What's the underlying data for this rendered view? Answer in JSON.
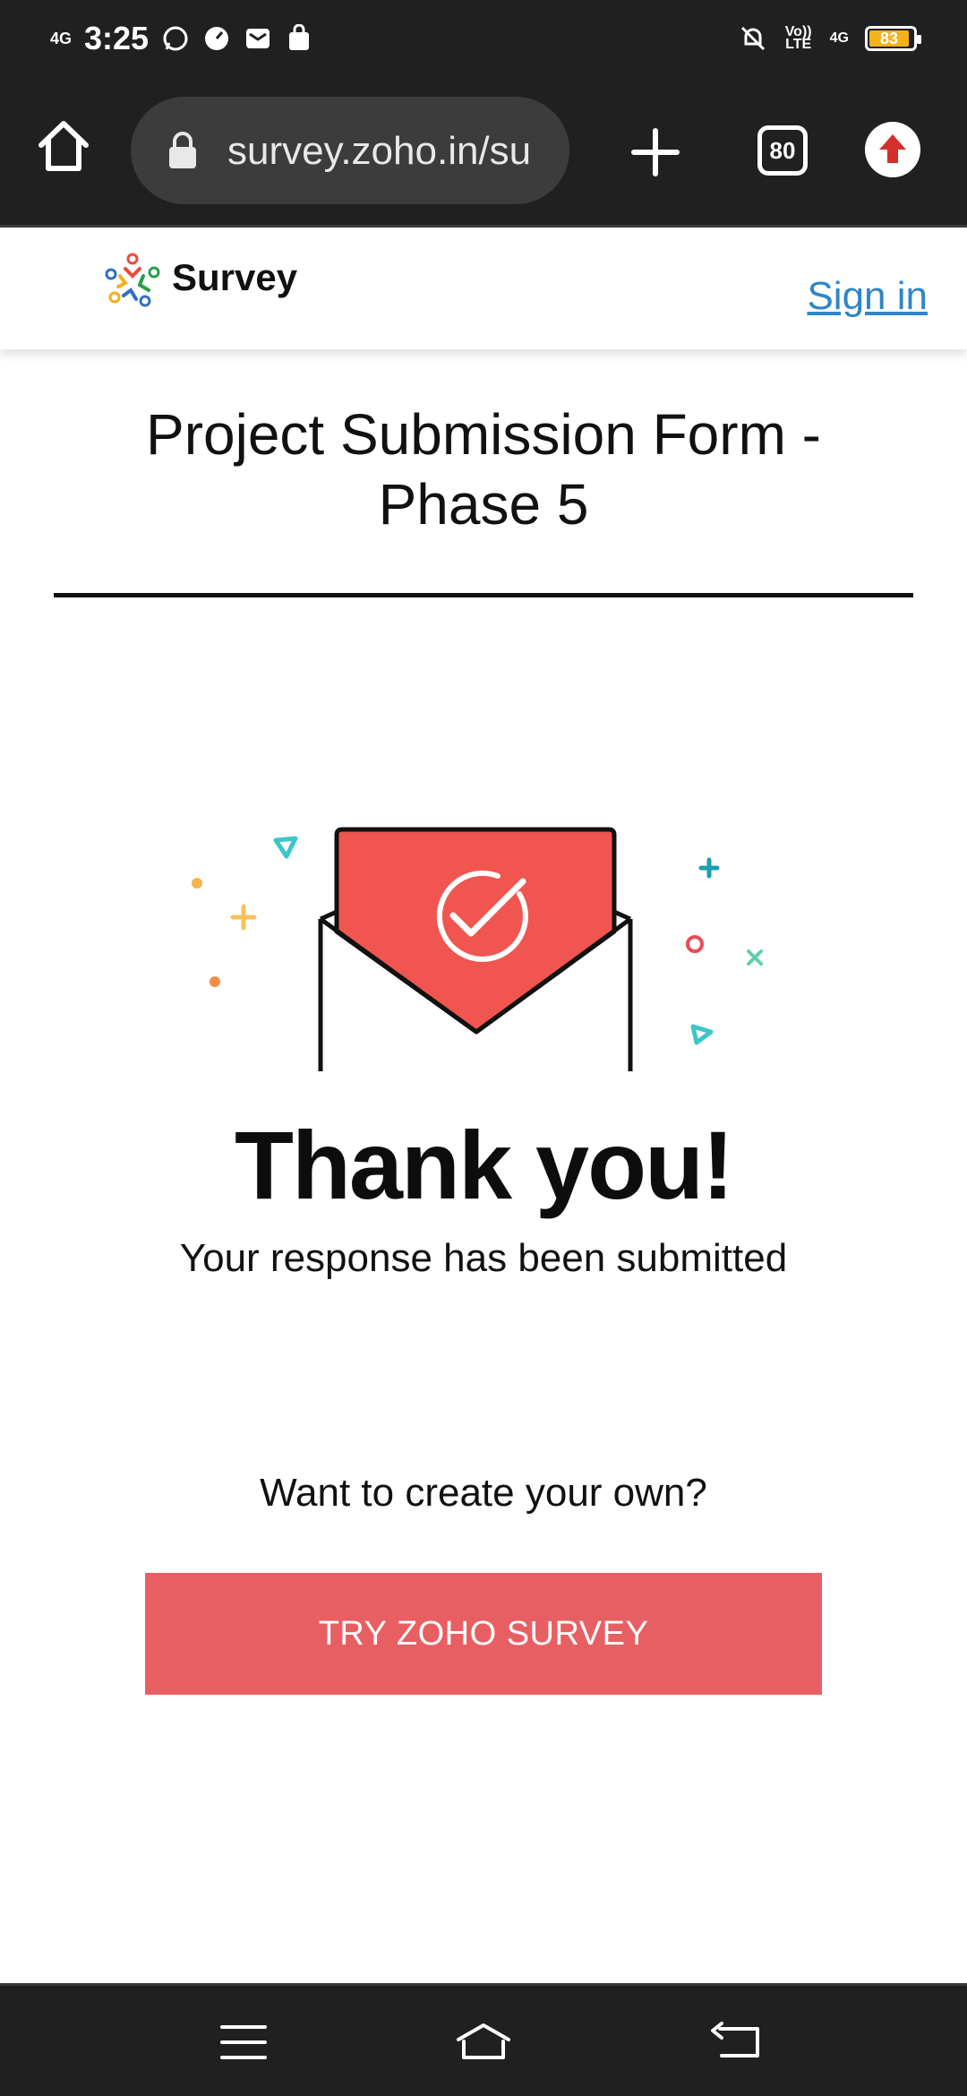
{
  "status_bar": {
    "network": "4G",
    "time": "3:25",
    "volte": "Vo)) LTE",
    "network2": "4G",
    "battery": "83"
  },
  "browser": {
    "url": "survey.zoho.in/su",
    "tab_count": "80"
  },
  "header": {
    "brand": "Survey",
    "sign_in": "Sign in"
  },
  "form": {
    "title": "Project Submission Form - Phase 5"
  },
  "confirmation": {
    "heading": "Thank you!",
    "message": "Your response has been submitted"
  },
  "promo": {
    "prompt": "Want to create your own?",
    "button": "TRY ZOHO SURVEY"
  },
  "colors": {
    "accent": "#e85f63",
    "link": "#2f86c7",
    "chrome": "#202020"
  }
}
